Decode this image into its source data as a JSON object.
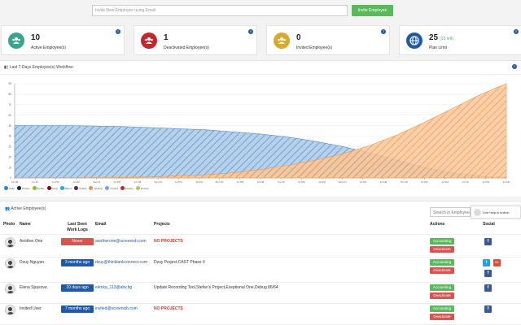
{
  "invite": {
    "placeholder": "Invite New Employee using Email",
    "button": "Invite Employee"
  },
  "cards": [
    {
      "number": "10",
      "label": "Active Employee(s)",
      "color": "#3aa58f",
      "icon": "users-icon"
    },
    {
      "number": "1",
      "label": "Deactivated Employee(s)",
      "color": "#c0282d",
      "icon": "users-icon"
    },
    {
      "number": "0",
      "label": "Invited Employee(s)",
      "color": "#d8a92e",
      "icon": "users-icon"
    },
    {
      "number": "25",
      "extra": "(15 left)",
      "label": "Plan Limit",
      "color": "#1f5aa6",
      "icon": "globe-icon"
    }
  ],
  "workflow": {
    "title": "Last 7 Days Employee(s) Workflow",
    "chart_data": {
      "type": "area",
      "title": "",
      "ylim": [
        0,
        90
      ],
      "y_ticks": [
        "0",
        "10",
        "20",
        "30",
        "40",
        "50",
        "60",
        "70",
        "80",
        "90"
      ],
      "x_ticks": [
        "12 AM",
        "Fri 22",
        "12 PM",
        "12 AM",
        "Sat 23",
        "12 PM",
        "12 AM",
        "Sun 24",
        "12 PM",
        "12 AM",
        "Mon 25",
        "12 PM",
        "12 AM",
        "Tue 26",
        "12 PM",
        "12 AM",
        "Wed 27",
        "12 PM",
        "12 AM",
        "Thu 28",
        "12 PM",
        "12 AM",
        "Fri 29",
        "12 PM",
        "12 AM"
      ],
      "series": [
        {
          "color": "#6fa6d6",
          "values": [
            50,
            50,
            50,
            49.5,
            49,
            48,
            47,
            46,
            44,
            42,
            39,
            35,
            30,
            24,
            17,
            10,
            5,
            2,
            0.5
          ]
        },
        {
          "color": "#f7a35c",
          "values": [
            0,
            0,
            0,
            0.2,
            0.5,
            1,
            2,
            3,
            5,
            8,
            12,
            17,
            23,
            31,
            41,
            53,
            66,
            79,
            90
          ]
        }
      ]
    },
    "legend": [
      "Hulio",
      "Onefac",
      "Auklaz",
      "Swop",
      "Blena",
      "Onefac",
      "Apolimo",
      "Cerlied",
      "Poeilop",
      "Ihenlop"
    ],
    "legend_colors": [
      "#2f7ed8",
      "#0d233a",
      "#8bbc21",
      "#910000",
      "#1aadce",
      "#492970",
      "#f28f43",
      "#77a1e5",
      "#c42525",
      "#a6c96a"
    ]
  },
  "users": {
    "title": "Active Employee(s)",
    "search_placeholder": "Search in Employee",
    "live_help": "Live help is online...",
    "columns": [
      "Photo",
      "Name",
      "Last Seen Work Logs",
      "Email",
      "Projects",
      "Actions",
      "Social"
    ],
    "rows": [
      {
        "name": "Another One",
        "seen": "Never",
        "seen_color": "#d9534f",
        "email": "anotherone@screenish.com",
        "projects": "NO PROJECTS",
        "no_projects": true,
        "social": [
          "f"
        ]
      },
      {
        "name": "Dzuy Nguyen",
        "seen": "3 months ago",
        "seen_color": "#1f5aa6",
        "email": "dzuy@thinktankconnect.com",
        "projects": "Dzuy Project,CAST Phase II",
        "no_projects": false,
        "social": [
          "t",
          "g",
          "f"
        ]
      },
      {
        "name": "Elena Spasova",
        "seen": "10 days ago",
        "seen_color": "#1f5aa6",
        "email": "elenka_113@abv.bg",
        "projects": "Update Recording Tool,Stefan's Project,Exeptional One,Debug 86/64",
        "no_projects": false,
        "social": [
          "f"
        ]
      },
      {
        "name": "Invited User",
        "seen": "7 months ago",
        "seen_color": "#1f5aa6",
        "email": "invited@screenish.com",
        "projects": "NO PROJECTS",
        "no_projects": true,
        "social": [
          "f"
        ]
      }
    ],
    "actions": {
      "accounting": "Accounting",
      "deactivate": "Deactivate"
    }
  }
}
